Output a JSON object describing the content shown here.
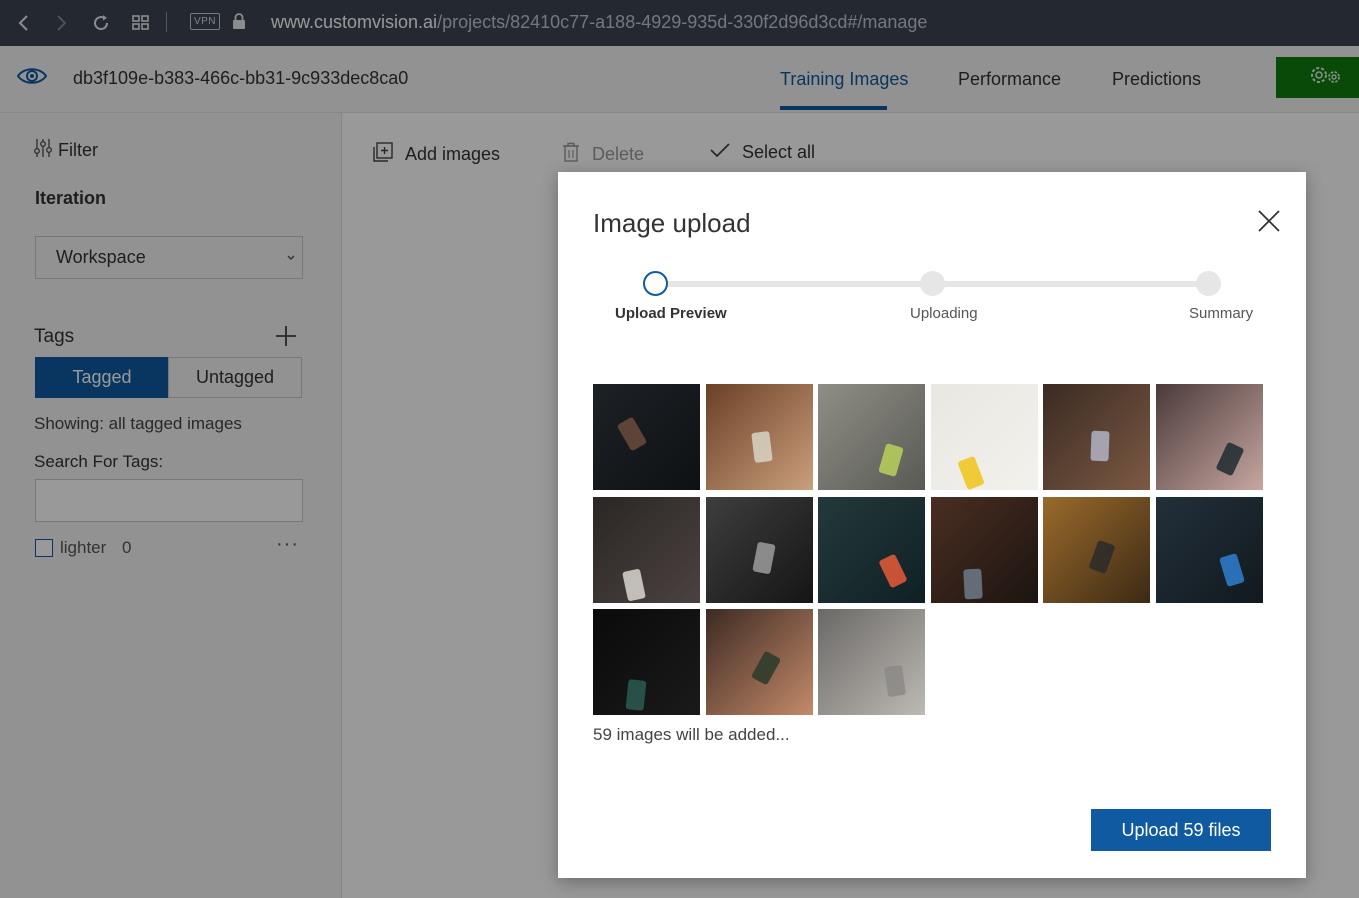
{
  "browser": {
    "url_host": "www.customvision.ai",
    "url_path": "/projects/82410c77-a188-4929-935d-330f2d96d3cd#/manage",
    "vpn_label": "VPN",
    "icons": [
      "back-icon",
      "forward-icon",
      "reload-icon",
      "tabs-grid-icon",
      "lock-icon"
    ]
  },
  "header": {
    "project_id": "db3f109e-b383-466c-bb31-9c933dec8ca0",
    "tabs": [
      {
        "label": "Training Images",
        "active": true
      },
      {
        "label": "Performance",
        "active": false
      },
      {
        "label": "Predictions",
        "active": false
      }
    ],
    "settings_icon": "gear-icon",
    "brand_color": "#107c10",
    "accent_color": "#0f5aa0"
  },
  "sidebar": {
    "filter_label": "Filter",
    "iteration_label": "Iteration",
    "iteration_value": "Workspace",
    "tags_label": "Tags",
    "tagged_label": "Tagged",
    "untagged_label": "Untagged",
    "showing_text": "Showing: all tagged images",
    "search_label": "Search For Tags:",
    "search_value": "",
    "tags": [
      {
        "name": "lighter",
        "count": "0",
        "checked": false
      }
    ],
    "more_label": "···"
  },
  "toolbar": {
    "add_images": "Add images",
    "delete": "Delete",
    "select_all": "Select all"
  },
  "dialog": {
    "title": "Image upload",
    "steps": [
      {
        "label": "Upload Preview",
        "state": "active"
      },
      {
        "label": "Uploading",
        "state": "pending"
      },
      {
        "label": "Summary",
        "state": "pending"
      }
    ],
    "thumbnails": [
      {
        "name": "thumb-dark-curtain",
        "c1": "#1d2125",
        "c2": "#0e1114",
        "accent": "#6b4b3c"
      },
      {
        "name": "thumb-bottle-table",
        "c1": "#6b3f26",
        "c2": "#c9a07c",
        "accent": "#d9d2c4"
      },
      {
        "name": "thumb-phone-mug",
        "c1": "#8f8e86",
        "c2": "#5a5a55",
        "accent": "#b8d05a"
      },
      {
        "name": "thumb-white-mug",
        "c1": "#e9e7e2",
        "c2": "#f3f1ec",
        "accent": "#f0c419"
      },
      {
        "name": "thumb-dirt-lighter",
        "c1": "#3a2a22",
        "c2": "#7c5a44",
        "accent": "#b0b4c4"
      },
      {
        "name": "thumb-phone-table",
        "c1": "#4a3a3a",
        "c2": "#c7a6a0",
        "accent": "#1f2a30"
      },
      {
        "name": "thumb-card-leather",
        "c1": "#2b2624",
        "c2": "#4a4240",
        "accent": "#d9d6cf"
      },
      {
        "name": "thumb-zippo-bw",
        "c1": "#3e3e3e",
        "c2": "#151515",
        "accent": "#9c9c9c"
      },
      {
        "name": "thumb-teal-lighter",
        "c1": "#24393d",
        "c2": "#0f2024",
        "accent": "#e85b3a"
      },
      {
        "name": "thumb-soil-lighter",
        "c1": "#4a2e22",
        "c2": "#1c1410",
        "accent": "#6d7a8a"
      },
      {
        "name": "thumb-camping-lighter",
        "c1": "#9a6a2c",
        "c2": "#3c2a14",
        "accent": "#2a2a2a"
      },
      {
        "name": "thumb-woven-blue",
        "c1": "#22303a",
        "c2": "#12191f",
        "accent": "#2f7fd0"
      },
      {
        "name": "thumb-flame-zippo",
        "c1": "#0a0a0a",
        "c2": "#1a1a1a",
        "accent": "#2a5a52"
      },
      {
        "name": "thumb-hand-lighter",
        "c1": "#3c2a22",
        "c2": "#c48a6a",
        "accent": "#2a3a2a"
      },
      {
        "name": "thumb-silver-lighter",
        "c1": "#6a6866",
        "c2": "#bdbab4",
        "accent": "#8c8a86"
      }
    ],
    "adding_text": "59 images will be added...",
    "upload_label": "Upload 59 files"
  }
}
